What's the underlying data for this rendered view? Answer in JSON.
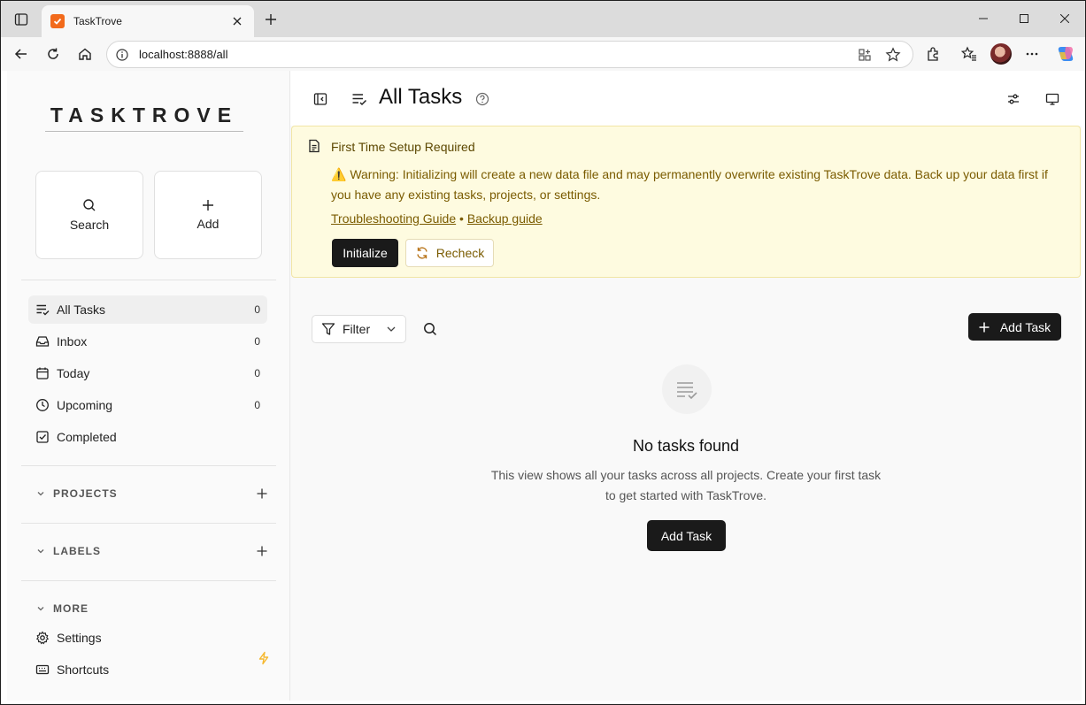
{
  "browser": {
    "tab_title": "TaskTrove",
    "url": "localhost:8888/all"
  },
  "sidebar": {
    "logo": "TASKTROVE",
    "quick": {
      "search_label": "Search",
      "add_label": "Add"
    },
    "nav": [
      {
        "label": "All Tasks",
        "count": "0",
        "icon": "list-check-icon"
      },
      {
        "label": "Inbox",
        "count": "0",
        "icon": "inbox-icon"
      },
      {
        "label": "Today",
        "count": "0",
        "icon": "calendar-icon"
      },
      {
        "label": "Upcoming",
        "count": "0",
        "icon": "clock-icon"
      },
      {
        "label": "Completed",
        "count": "",
        "icon": "check-square-icon"
      }
    ],
    "sections": {
      "projects": "PROJECTS",
      "labels": "LABELS",
      "more": "MORE"
    },
    "more_items": [
      {
        "label": "Settings",
        "icon": "gear-icon"
      },
      {
        "label": "Shortcuts",
        "icon": "keyboard-icon"
      }
    ]
  },
  "header": {
    "title": "All Tasks"
  },
  "banner": {
    "title": "First Time Setup Required",
    "warning": "⚠️ Warning: Initializing will create a new data file and may permanently overwrite existing TaskTrove data. Back up your data first if you have any existing tasks, projects, or settings.",
    "link_troubleshooting": "Troubleshooting Guide",
    "separator": "•",
    "link_backup": "Backup guide",
    "initialize_label": "Initialize",
    "recheck_label": "Recheck"
  },
  "toolbar": {
    "filter_label": "Filter",
    "add_task_label": "Add Task"
  },
  "empty": {
    "title": "No tasks found",
    "description": "This view shows all your tasks across all projects. Create your first task to get started with TaskTrove.",
    "add_task_label": "Add Task"
  },
  "colors": {
    "banner_bg": "#fefbe0",
    "banner_text": "#7a5b00",
    "primary_button": "#1a1a1a",
    "favicon": "#f26a1b",
    "bolt": "#f5b82e"
  }
}
